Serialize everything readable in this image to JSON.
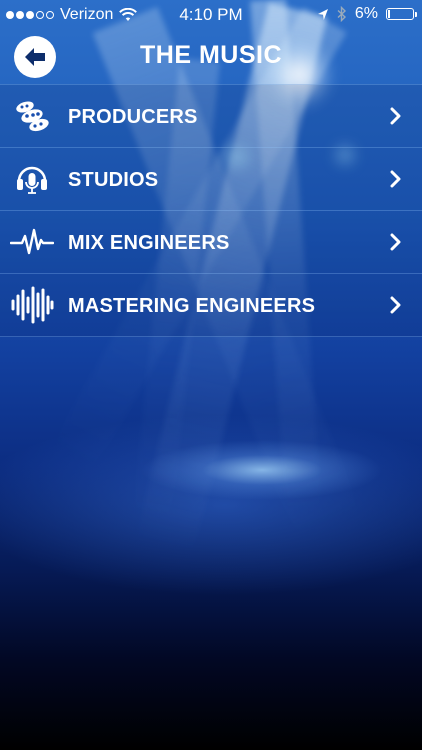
{
  "status_bar": {
    "carrier": "Verizon",
    "signal_bars_filled": 3,
    "signal_bars_total": 5,
    "time": "4:10 PM",
    "battery_percent": "6%",
    "battery_level": 0.06,
    "icons": [
      "wifi-icon",
      "location-arrow-icon",
      "bluetooth-icon",
      "battery-icon"
    ]
  },
  "header": {
    "title": "THE MUSIC",
    "back_icon": "back-arrow-icon"
  },
  "menu": {
    "items": [
      {
        "label": "PRODUCERS",
        "icon": "film-reel-icon"
      },
      {
        "label": "STUDIOS",
        "icon": "headphones-microphone-icon"
      },
      {
        "label": "MIX ENGINEERS",
        "icon": "waveform-pulse-icon"
      },
      {
        "label": "MASTERING ENGINEERS",
        "icon": "sound-bars-icon"
      }
    ],
    "chevron_icon": "chevron-right-icon"
  },
  "colors": {
    "background_top": "#2c6fc9",
    "background_bottom": "#000000",
    "text": "#ffffff",
    "divider": "#96c8ff"
  }
}
